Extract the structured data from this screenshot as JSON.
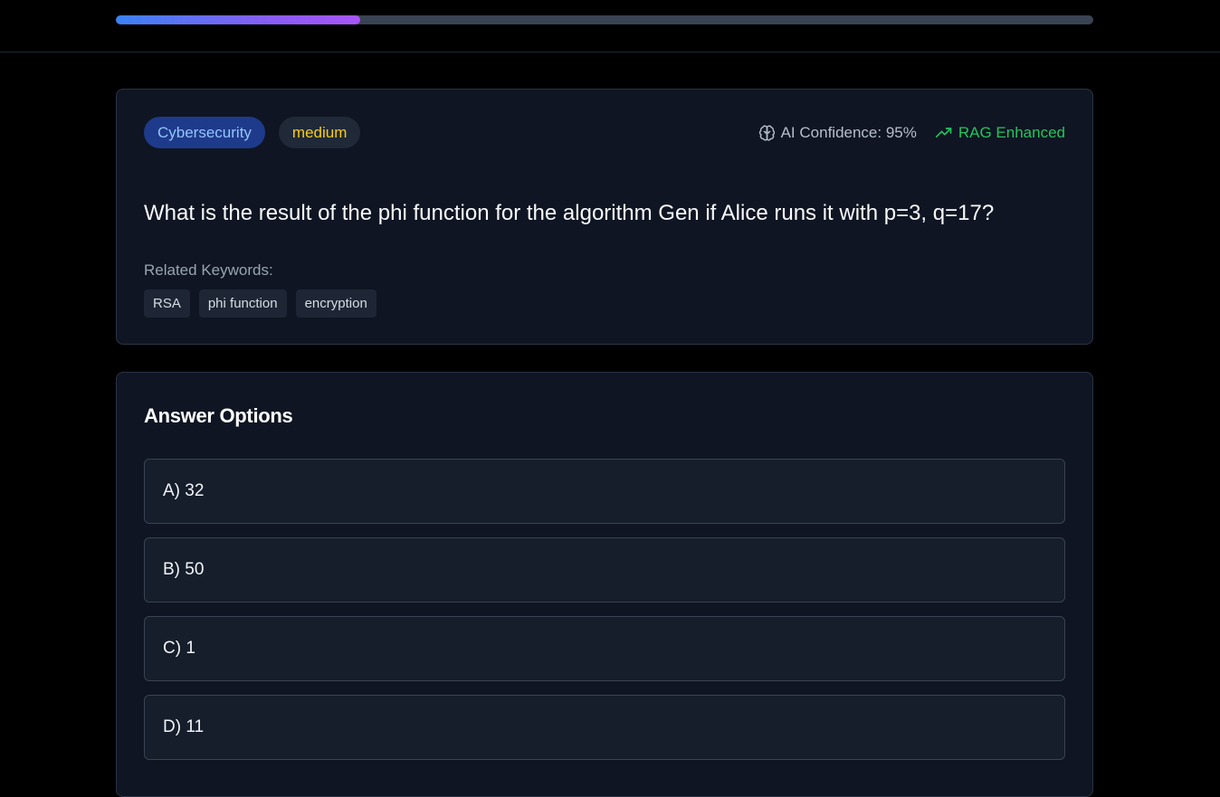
{
  "progress": {
    "fraction": 0.25
  },
  "question": {
    "topic_tag": "Cybersecurity",
    "difficulty_tag": "medium",
    "ai_confidence": "AI Confidence: 95%",
    "rag_label": "RAG Enhanced",
    "text": "What is the result of the phi function for the algorithm Gen if Alice runs it with p=3, q=17?",
    "keywords_label": "Related Keywords:",
    "keywords": [
      "RSA",
      "phi function",
      "encryption"
    ]
  },
  "answers": {
    "title": "Answer Options",
    "options": [
      "A) 32",
      "B) 50",
      "C) 1",
      "D) 11"
    ]
  },
  "colors": {
    "background": "#000000",
    "card": "#0f1522",
    "accent_blue": "#3b82f6",
    "accent_purple": "#a855f7",
    "topic_tag_bg": "#1e3a8a",
    "difficulty_text": "#facc15",
    "rag_green": "#22c55e"
  },
  "icons": {
    "confidence": "brain-icon",
    "rag": "trending-up-icon"
  }
}
